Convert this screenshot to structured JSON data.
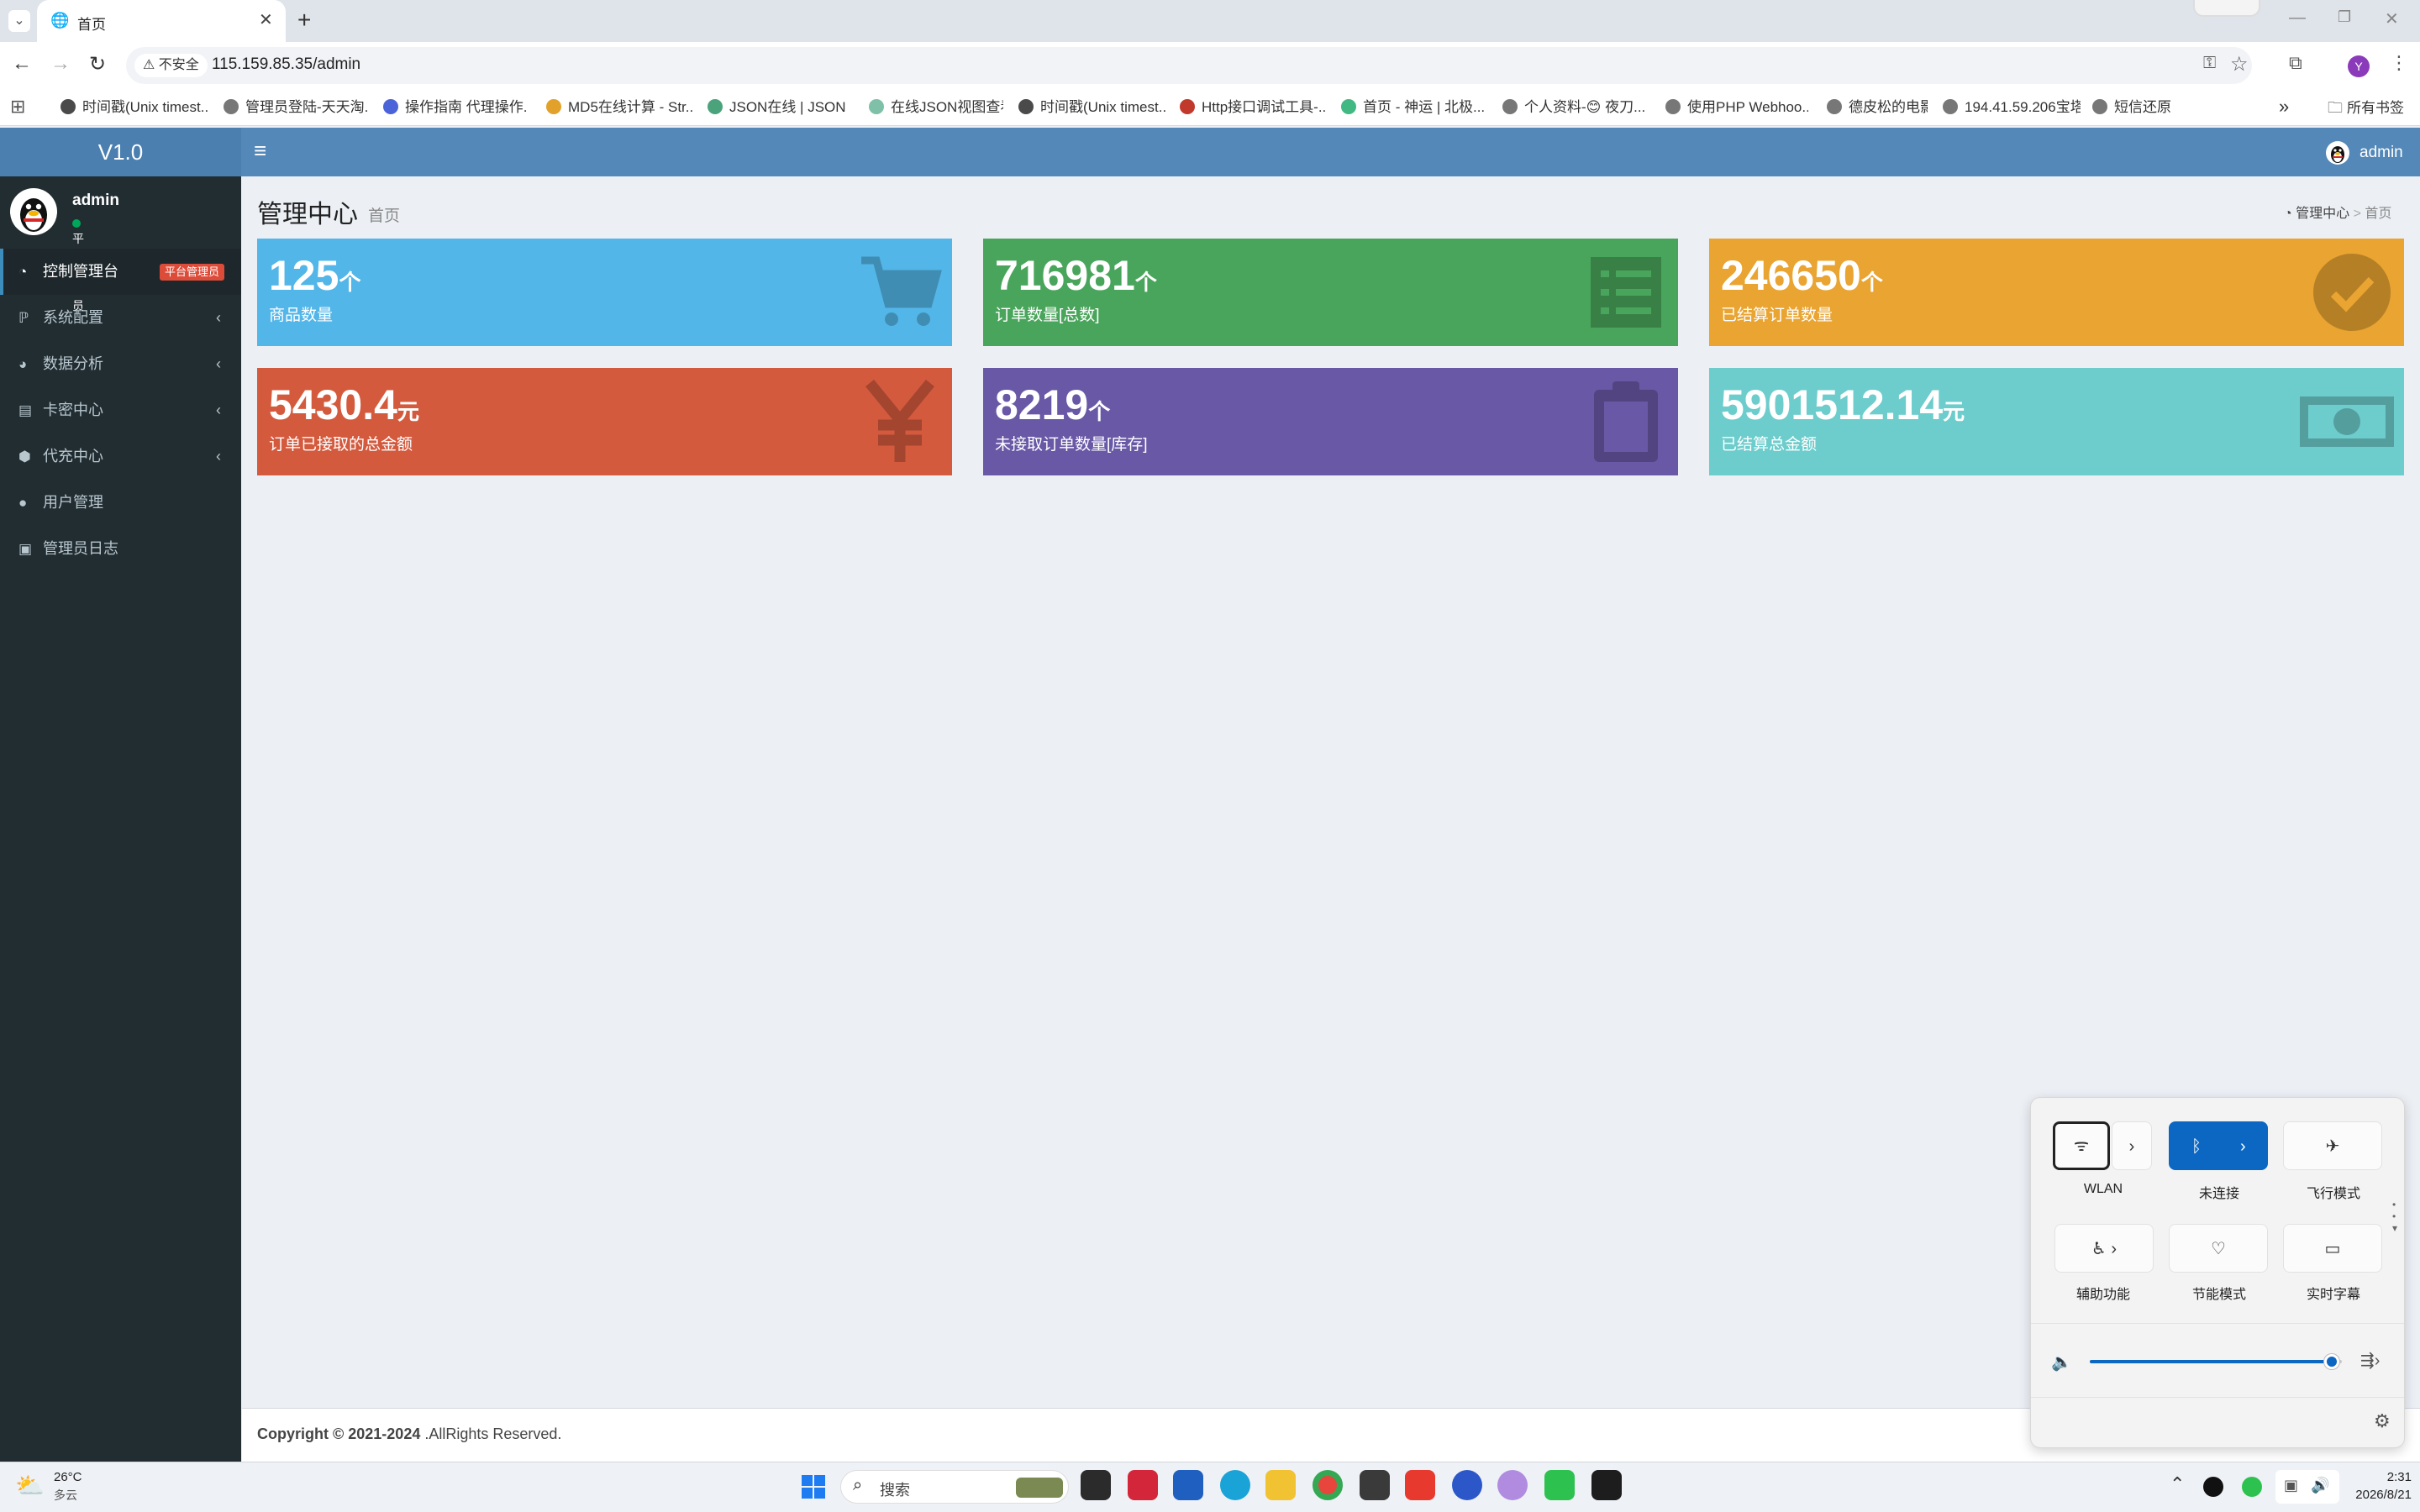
{
  "browser": {
    "tab_title": "首页",
    "security_label": "不安全",
    "url": "115.159.85.35/admin",
    "profile_initial": "Y",
    "bookmarks": [
      "时间戳(Unix timest...",
      "管理员登陆-天天淘...",
      "操作指南 代理操作...",
      "MD5在线计算 - Str...",
      "JSON在线 | JSON...",
      "在线JSON视图查看",
      "时间戳(Unix timest...",
      "Http接口调试工具-...",
      "首页 - 神运 | 北极...",
      "个人资料-😊 夜刀...",
      "使用PHP Webhoo...",
      "德皮松的电影",
      "194.41.59.206宝塔",
      "短信还原"
    ],
    "all_bookmarks_label": "所有书签"
  },
  "admin": {
    "version": "V1.0",
    "top_user": "admin",
    "user": {
      "name": "admin",
      "role": "平台管理员"
    },
    "menu": [
      {
        "label": "控制管理台",
        "icon": "dashboard-icon",
        "badge": "平台管理员"
      },
      {
        "label": "系统配置",
        "icon": "paypal-icon"
      },
      {
        "label": "数据分析",
        "icon": "compass-icon"
      },
      {
        "label": "卡密中心",
        "icon": "card-icon"
      },
      {
        "label": "代充中心",
        "icon": "cube-icon"
      },
      {
        "label": "用户管理",
        "icon": "user-icon"
      },
      {
        "label": "管理员日志",
        "icon": "log-icon"
      }
    ],
    "page": {
      "title": "管理中心",
      "subtitle": "首页",
      "breadcrumb": [
        "管理中心",
        "首页"
      ]
    },
    "stats": [
      {
        "value": "125",
        "unit": "个",
        "label": "商品数量",
        "color": "#53b6e8",
        "icon": "cart-icon"
      },
      {
        "value": "716981",
        "unit": "个",
        "label": "订单数量[总数]",
        "color": "#4aa55c",
        "icon": "list-icon"
      },
      {
        "value": "246650",
        "unit": "个",
        "label": "已结算订单数量",
        "color": "#e9a431",
        "icon": "check-circle-icon"
      },
      {
        "value": "5430.4",
        "unit": "元",
        "label": "订单已接取的总金额",
        "color": "#d45a3e",
        "icon": "yen-icon"
      },
      {
        "value": "8219",
        "unit": "个",
        "label": "未接取订单数量[库存]",
        "color": "#6958a6",
        "icon": "clipboard-icon"
      },
      {
        "value": "5901512.14",
        "unit": "元",
        "label": "已结算总金额",
        "color": "#6dcccc",
        "icon": "money-icon"
      }
    ],
    "footer": {
      "bold": "Copyright © 2021-2024",
      "text": " .AllRights Reserved."
    }
  },
  "quick_settings": {
    "tiles": [
      {
        "label": "WLAN",
        "icon": "wifi-icon"
      },
      {
        "label": "未连接",
        "icon": "bluetooth-icon"
      },
      {
        "label": "飞行模式",
        "icon": "airplane-icon"
      },
      {
        "label": "辅助功能",
        "icon": "accessibility-icon"
      },
      {
        "label": "节能模式",
        "icon": "leaf-icon"
      },
      {
        "label": "实时字幕",
        "icon": "captions-icon"
      }
    ],
    "volume": 0.96
  },
  "taskbar": {
    "weather_temp": "26°C",
    "weather_desc": "多云",
    "search_placeholder": "搜索",
    "time": "2:31",
    "date": "2026/8/21"
  }
}
